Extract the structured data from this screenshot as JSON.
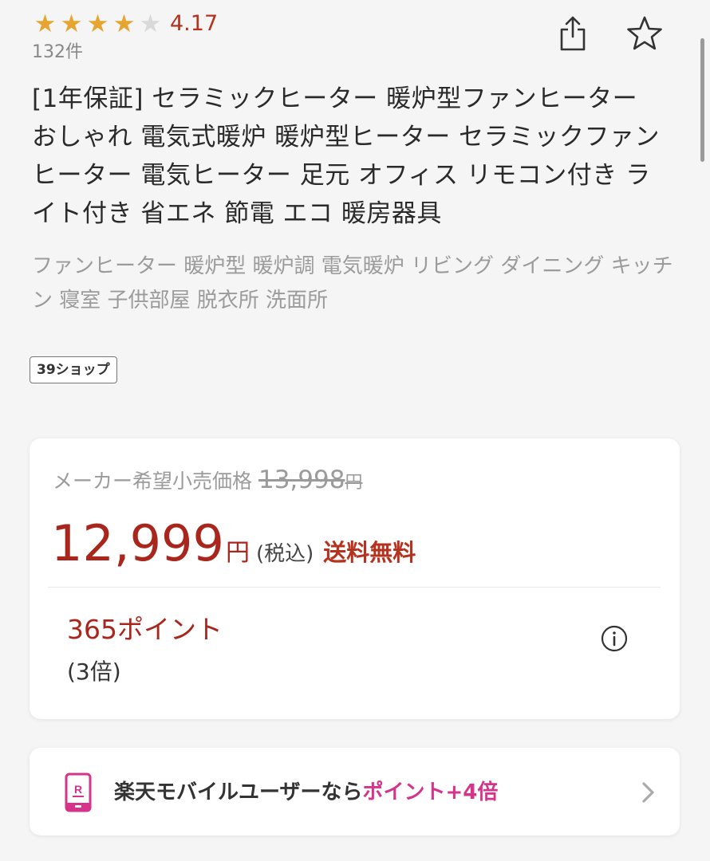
{
  "rating": {
    "score": "4.17",
    "stars_value": 4.17,
    "stars_max": 5,
    "review_count": "132件"
  },
  "actions": {
    "share_icon": "share-icon",
    "favorite_icon": "star-outline-icon"
  },
  "product": {
    "title": "[1年保証] セラミックヒーター 暖炉型ファンヒーター おしゃれ 電気式暖炉 暖炉型ヒーター セラミックファンヒーター 電気ヒーター 足元 オフィス リモコン付き ライト付き 省エネ 節電 エコ 暖房器具",
    "catchcopy": "ファンヒーター 暖炉型 暖炉調 電気暖炉 リビング ダイニング キッチン 寝室 子供部屋 脱衣所 洗面所",
    "shop_badge": "39ショップ"
  },
  "price": {
    "list_label": "メーカー希望小売価格",
    "list_amount": "13,998",
    "list_yen": "円",
    "sale_amount": "12,999",
    "sale_yen": "円",
    "tax_label": "(税込)",
    "shipping_label": "送料無料"
  },
  "points": {
    "label": "365ポイント",
    "multiplier": "(3倍)",
    "info_icon": "info-icon"
  },
  "mobile_promo": {
    "text": "楽天モバイルユーザーなら",
    "accent_text": "ポイント+4倍",
    "icon": "rakuten-mobile-icon"
  },
  "colors": {
    "star_full": "#e6a531",
    "star_empty": "#d9d9d9",
    "price_red": "#a9261c",
    "accent_pink": "#d6338a",
    "muted_gray": "#9b9b9b"
  }
}
